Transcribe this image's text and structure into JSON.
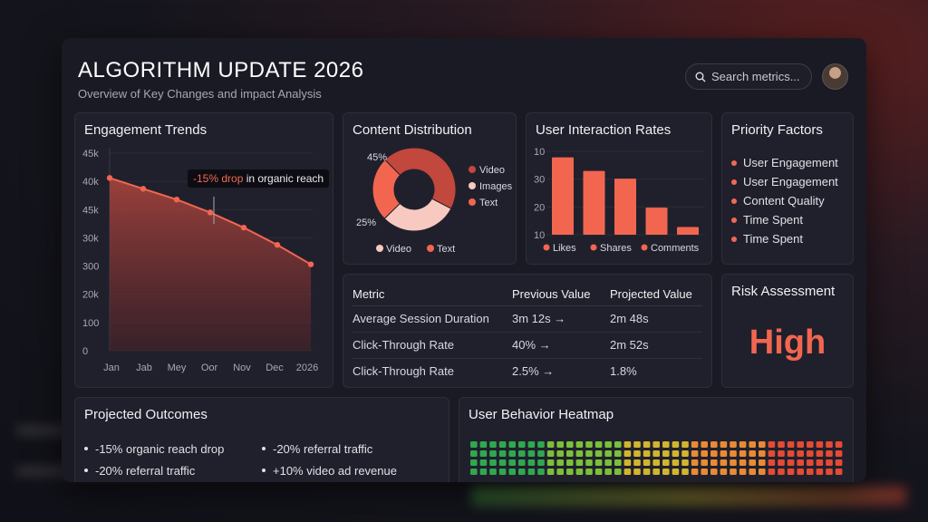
{
  "header": {
    "title": "ALGORITHM UPDATE 2026",
    "subtitle": "Overview of Key Changes and impact Analysis",
    "search_placeholder": "Search metrics..."
  },
  "engagement": {
    "title": "Engagement Trends",
    "tooltip_highlight": "-15% drop",
    "tooltip_rest": " in organic reach",
    "chart_data": {
      "type": "area",
      "title": "Engagement Trends",
      "y_tick_labels": [
        "45k",
        "40k",
        "45k",
        "30k",
        "300",
        "20k",
        "100",
        "0"
      ],
      "x_tick_labels": [
        "Jan",
        "Jab",
        "Mey",
        "Oor",
        "Nov",
        "Dec",
        "2026"
      ],
      "series": [
        {
          "values": [
            40,
            37.5,
            35,
            32,
            28.5,
            24.5,
            20
          ]
        }
      ],
      "ylim": [
        0,
        47
      ],
      "grid": true
    }
  },
  "distribution": {
    "title": "Content Distribution",
    "label_45": "45%",
    "label_25": "25%",
    "legend_right": [
      "Video",
      "Images",
      "Text"
    ],
    "legend_bottom": [
      "Video",
      "Text"
    ],
    "chart_data": {
      "type": "pie",
      "slices": [
        {
          "label": "Video",
          "value": 45,
          "color": "#c2473c"
        },
        {
          "label": "Images",
          "value": 30,
          "color": "#f7c9c0"
        },
        {
          "label": "Text",
          "value": 25,
          "color": "#f26650"
        }
      ]
    }
  },
  "interaction": {
    "title": "User Interaction Rates",
    "y_tick_labels": [
      "10",
      "30",
      "20",
      "10"
    ],
    "legend": [
      "Likes",
      "Shares",
      "Comments"
    ],
    "chart_data": {
      "type": "bar",
      "values": [
        40,
        33,
        29,
        14,
        4
      ],
      "ylim": [
        0,
        45
      ],
      "color": "#f26650"
    }
  },
  "priority": {
    "title": "Priority Factors",
    "items": [
      "User Engagement",
      "User Engagement",
      "Content Quality",
      "Time Spent",
      "Time Spent"
    ]
  },
  "metrics": {
    "headers": [
      "Metric",
      "Previous Value",
      "Projected Value"
    ],
    "rows": [
      [
        "Average Session Duration",
        "3m 12s →",
        "2m 48s"
      ],
      [
        "Click-Through Rate",
        "40% →",
        "2m 52s"
      ],
      [
        "Click-Through Rate",
        "2.5% →",
        "1.8%"
      ]
    ]
  },
  "risk": {
    "title": "Risk Assessment",
    "value": "High"
  },
  "outcomes": {
    "title": "Projected Outcomes",
    "left": [
      "-15% organic reach drop",
      "-20% referral traffic"
    ],
    "right": [
      "-20% referral traffic",
      "+10% video ad revenue"
    ]
  },
  "heatmap": {
    "title": "User Behavior Heatmap",
    "rows": 4,
    "cols": 39,
    "colors": [
      "#2fa84f",
      "#7bbf3a",
      "#d1b52e",
      "#e98a34",
      "#e44a34"
    ]
  },
  "colors": {
    "accent": "#f26650",
    "background": "#1a1a24"
  }
}
